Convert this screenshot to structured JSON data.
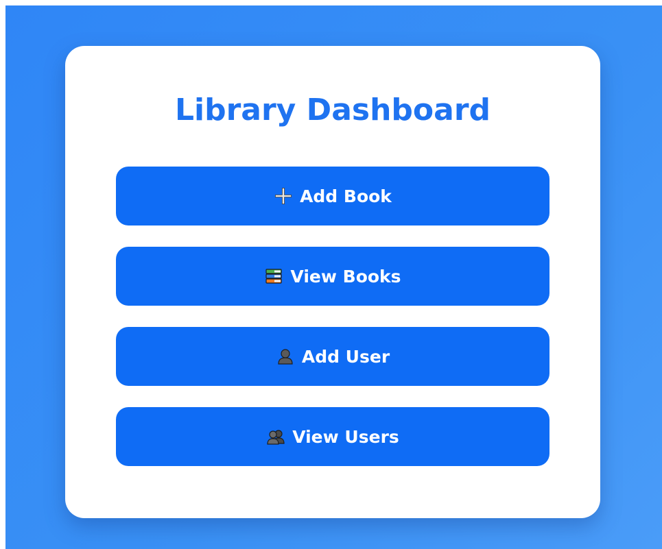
{
  "colors": {
    "title": "#1f73f0",
    "button_bg": "#0f6cf5",
    "button_text": "#ffffff"
  },
  "dashboard": {
    "title": "Library Dashboard",
    "buttons": [
      {
        "label": "Add Book",
        "icon": "plus-icon"
      },
      {
        "label": "View Books",
        "icon": "books-icon"
      },
      {
        "label": "Add User",
        "icon": "user-icon"
      },
      {
        "label": "View Users",
        "icon": "users-icon"
      }
    ]
  }
}
